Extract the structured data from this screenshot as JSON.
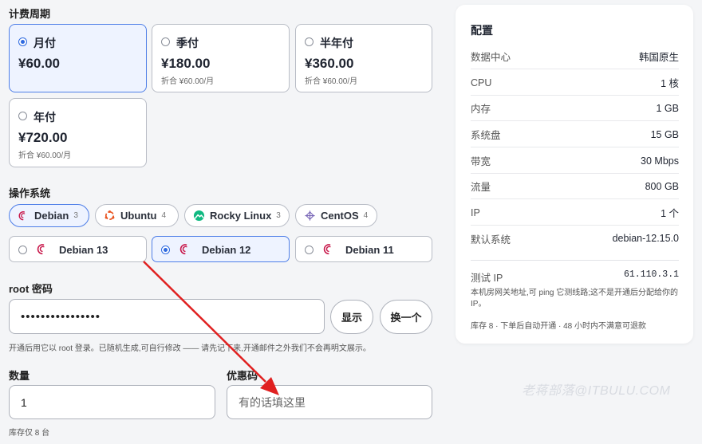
{
  "billing": {
    "title": "计费周期",
    "options": [
      {
        "name": "月付",
        "price": "¥60.00",
        "sub": "",
        "selected": true
      },
      {
        "name": "季付",
        "price": "¥180.00",
        "sub": "折合 ¥60.00/月",
        "selected": false
      },
      {
        "name": "半年付",
        "price": "¥360.00",
        "sub": "折合 ¥60.00/月",
        "selected": false
      },
      {
        "name": "年付",
        "price": "¥720.00",
        "sub": "折合 ¥60.00/月",
        "selected": false
      }
    ]
  },
  "os": {
    "title": "操作系统",
    "families": [
      {
        "name": "Debian",
        "count": "3",
        "icon": "debian-icon",
        "selected": true
      },
      {
        "name": "Ubuntu",
        "count": "4",
        "icon": "ubuntu-icon",
        "selected": false
      },
      {
        "name": "Rocky Linux",
        "count": "3",
        "icon": "rocky-linux-icon",
        "selected": false
      },
      {
        "name": "CentOS",
        "count": "4",
        "icon": "centos-icon",
        "selected": false
      }
    ],
    "versions": [
      {
        "name": "Debian 13",
        "selected": false
      },
      {
        "name": "Debian 12",
        "selected": true
      },
      {
        "name": "Debian 11",
        "selected": false
      }
    ]
  },
  "password": {
    "label": "root 密码",
    "value": "••••••••••••••••",
    "show_label": "显示",
    "regen_label": "换一个",
    "hint": "开通后用它以 root 登录。已随机生成,可自行修改 —— 请先记下来,开通邮件之外我们不会再明文展示。"
  },
  "quantity": {
    "label": "数量",
    "value": "1",
    "hint": "库存仅 8 台"
  },
  "coupon": {
    "label": "优惠码",
    "placeholder": "有的话填这里"
  },
  "config": {
    "title": "配置",
    "rows": [
      {
        "key": "数据中心",
        "value": "韩国原生"
      },
      {
        "key": "CPU",
        "value": "1 核"
      },
      {
        "key": "内存",
        "value": "1 GB"
      },
      {
        "key": "系统盘",
        "value": "15 GB"
      },
      {
        "key": "带宽",
        "value": "30 Mbps"
      },
      {
        "key": "流量",
        "value": "800 GB"
      },
      {
        "key": "IP",
        "value": "1 个"
      },
      {
        "key": "默认系统",
        "value": "debian-12.15.0"
      }
    ],
    "test_ip_label": "测试 IP",
    "test_ip_value": "61.110.3.1",
    "note": "本机房网关地址,可 ping 它测线路;这不是开通后分配给你的 IP。",
    "stock": "库存 8 · 下单后自动开通 · 48 小时内不满意可退款"
  },
  "watermark": "老蒋部落@ITBULU.COM",
  "colors": {
    "accent": "#2f6ae0",
    "arrow": "#e02020"
  }
}
